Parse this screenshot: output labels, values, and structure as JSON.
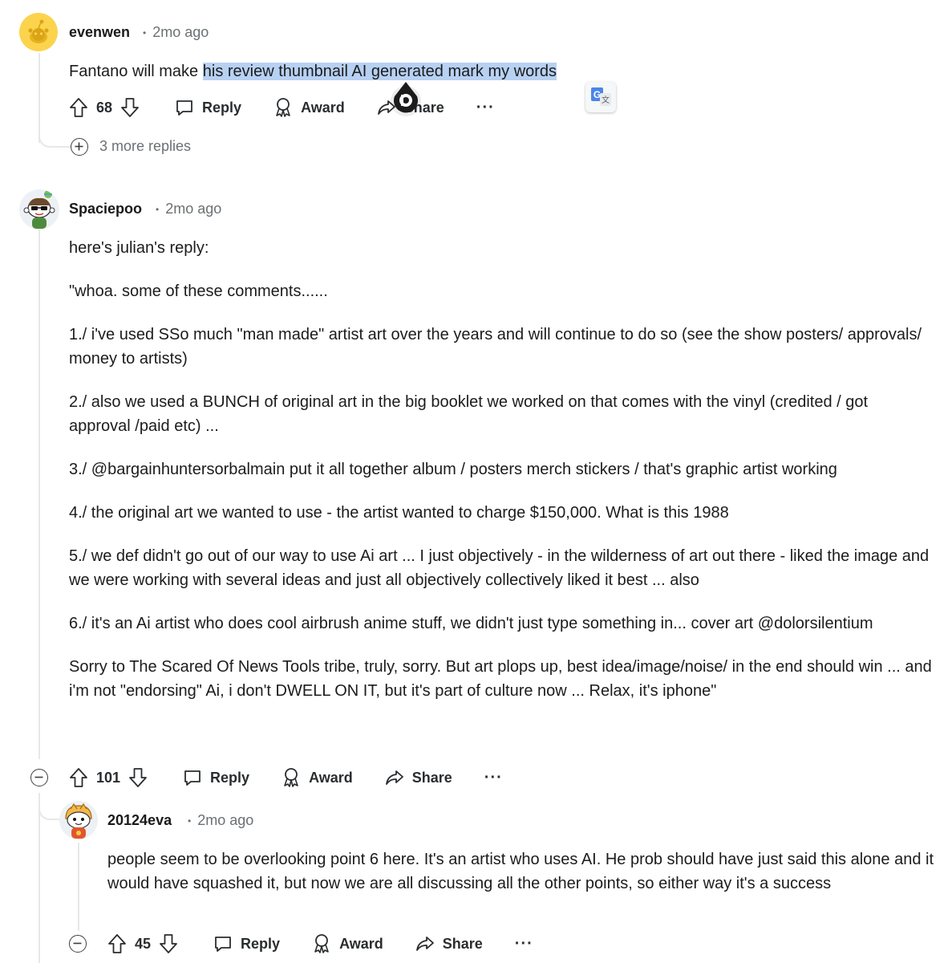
{
  "comments": [
    {
      "username": "evenwen",
      "age": "2mo ago",
      "text_plain": "Fantano will make ",
      "text_highlight": "his review thumbnail AI generated mark my words",
      "votes": "68",
      "more_replies": "3 more replies"
    },
    {
      "username": "Spaciepoo",
      "age": "2mo ago",
      "paragraphs": [
        "here's julian's reply:",
        "\"whoa. some of these comments......",
        "1./ i've used SSo much \"man made\" artist art over the years and will continue to do so (see the show posters/ approvals/ money to artists)",
        "2./ also we used a BUNCH of original art in the big booklet we worked on that comes with the vinyl (credited / got approval /paid etc) ...",
        "3./ @bargainhuntersorbalmain put it all together album / posters merch stickers / that's graphic artist working",
        "4./ the original art we wanted to use - the artist wanted to charge $150,000. What is this 1988",
        "5./ we def didn't go out of our way to use Ai art ... I just objectively - in the wilderness of art out there - liked the image and we were working with several ideas and just all objectively collectively liked it best ... also",
        "6./ it's an Ai artist who does cool airbrush anime stuff, we didn't just type something in... cover art @dolorsilentium",
        "Sorry to The Scared Of News Tools tribe, truly, sorry. But art plops up, best idea/image/noise/ in the end should win ... and i'm not \"endorsing\" Ai, i don't DWELL ON IT, but it's part of culture now ... Relax, it's iphone\""
      ],
      "votes": "101"
    },
    {
      "username": "20124eva",
      "age": "2mo ago",
      "paragraphs": [
        "people seem to be overlooking point 6 here. It's an artist who uses AI. He prob should have just said this alone and it would have squashed it, but now we are all discussing all the other points, so either way it's a success"
      ],
      "votes": "45"
    }
  ],
  "actions": {
    "reply": "Reply",
    "award": "Award",
    "share": "Share",
    "more": "···"
  },
  "colors": {
    "highlight": "#b7d1f3",
    "thread_line": "#e5e8ea",
    "meta_text": "#6b7073",
    "avatar_yellow": "#fcd34d"
  },
  "icons": [
    "snoo-avatar",
    "upvote-icon",
    "downvote-icon",
    "reply-icon",
    "award-icon",
    "share-icon",
    "more-icon",
    "expand-icon",
    "collapse-icon",
    "translate-icon",
    "cursor-overlay-icon"
  ]
}
